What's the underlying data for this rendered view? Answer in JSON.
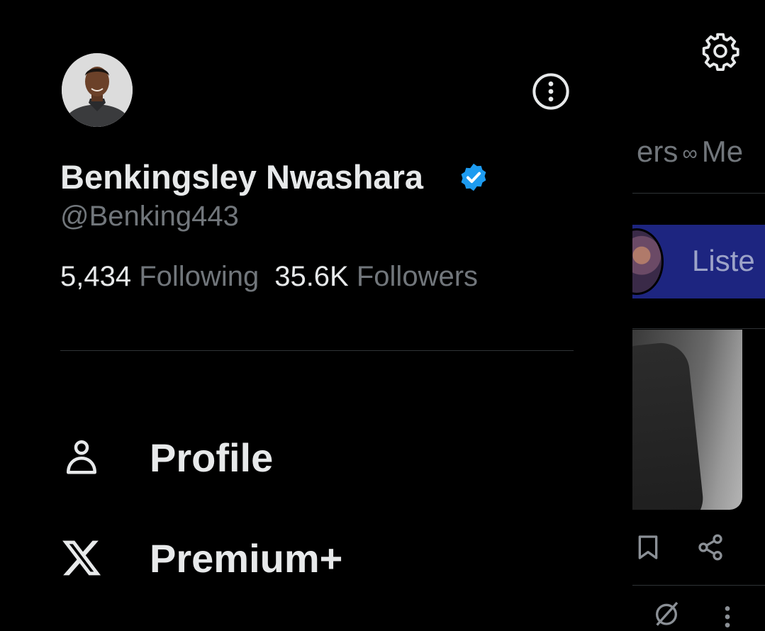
{
  "drawer": {
    "user": {
      "display_name": "Benkingsley Nwashara",
      "handle": "@Benking443",
      "verified": true,
      "following_count": "5,434",
      "following_label": "Following",
      "followers_count": "35.6K",
      "followers_label": "Followers"
    },
    "menu": [
      {
        "label": "Profile",
        "icon": "person-icon"
      },
      {
        "label": "Premium+",
        "icon": "x-logo-icon"
      }
    ]
  },
  "feed": {
    "tabs_partial": [
      "ers",
      "Me"
    ],
    "tabs_separator": "∞",
    "spaces_label": "Liste"
  },
  "colors": {
    "background": "#000000",
    "text_primary": "#e7e9ea",
    "text_secondary": "#71767b",
    "verified_blue": "#1d9bf0",
    "spaces_bar": "#1d2580",
    "divider": "#2f3336"
  }
}
